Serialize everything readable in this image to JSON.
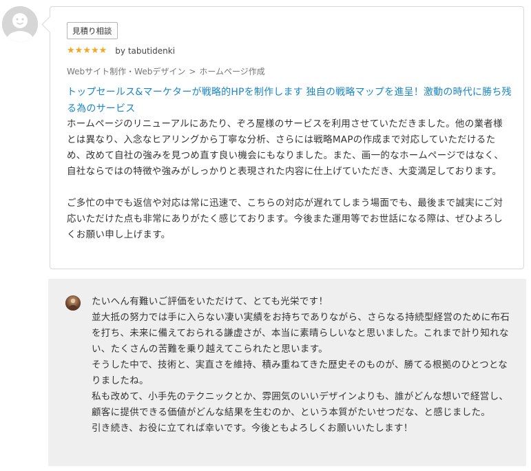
{
  "review": {
    "tag": "見積り相談",
    "rating": 5,
    "author": "by tabutidenki",
    "breadcrumb": [
      "Webサイト制作・Webデザイン",
      "ホームページ作成"
    ],
    "breadcrumb_separator": ">",
    "service_title": "トップセールス&マーケターが戦略的HPを制作します 独自の戦略マップを進呈！激動の時代に勝ち残る為のサービス",
    "body": [
      "ホームページのリニューアルにあたり、ぞろ屋様のサービスを利用させていただきました。他の業者様とは異なり、入念なヒアリングから丁寧な分析、さらには戦略MAPの作成まで対応していただけるため、改めて自社の強みを見つめ直す良い機会にもなりました。また、画一的なホームページではなく、自社ならではの特徴や強みがしっかりと表現された内容に仕上げていただき、大変満足しております。",
      "ご多忙の中でも返信や対応は常に迅速で、こちらの対応が遅れてしまう場面でも、最後まで誠実にご対応いただけた点も非常にありがたく感じております。今後また運用等でお世話になる際は、ぜひよろしくお願い申し上げます。"
    ]
  },
  "reply": {
    "lines": [
      "たいへん有難いご評価をいただけて、とても光栄です！",
      "並大抵の努力では手に入らない凄い実績をお持ちでありながら、さらなる持続型経営のために布石を打ち、未来に備えておられる謙虚さが、本当に素晴らしいなと思いました。これまで計り知れない、たくさんの苦難を乗り越えてこられたと思います。",
      "そうした中で、技術と、実直さを維持、積み重ねてきた歴史そのものが、勝てる根拠のひとつとなりましたね。",
      "私も改めて、小手先のテクニックとか、雰囲気のいいデザインよりも、誰がどんな想いで経営し、顧客に提供できる価値がどんな結果を生むのか、という本質がたいせつだな、と感じました。",
      "引き続き、お役に立てれば幸いです。今後ともよろしくお願いいたします！"
    ]
  },
  "icons": {
    "user_avatar": "default-user-avatar-icon",
    "seller_avatar": "seller-avatar-icon",
    "star": "star-icon"
  },
  "colors": {
    "star": "#f5a623",
    "link": "#1a85c8",
    "reply_bg": "#efefef"
  }
}
